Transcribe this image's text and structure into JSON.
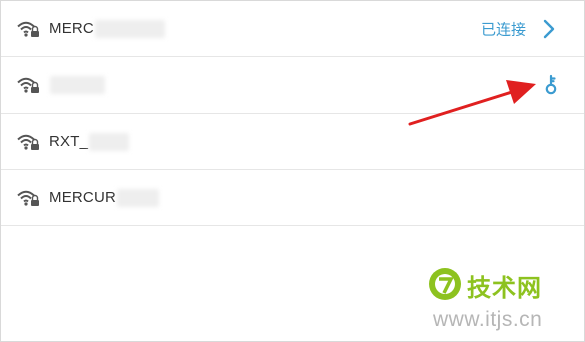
{
  "networks": [
    {
      "ssid": "MERC",
      "status": "已连接",
      "icon": "wifi-locked-icon",
      "action_icon": "chevron-right-icon"
    },
    {
      "ssid": "",
      "status": "",
      "icon": "wifi-locked-icon",
      "action_icon": "key-icon"
    },
    {
      "ssid": "RXT_",
      "status": "",
      "icon": "wifi-locked-icon",
      "action_icon": ""
    },
    {
      "ssid": "MERCUR",
      "status": "",
      "icon": "wifi-locked-icon",
      "action_icon": ""
    }
  ],
  "annotation": {
    "type": "red-arrow",
    "target": "key-icon"
  },
  "watermark": {
    "brand": "技术网",
    "url": "www.itjs.cn"
  },
  "colors": {
    "accent": "#3b9bd0",
    "arrow": "#e02020",
    "divider": "#e6e6e6",
    "icon": "#555555",
    "brand": "#8dc21f"
  }
}
